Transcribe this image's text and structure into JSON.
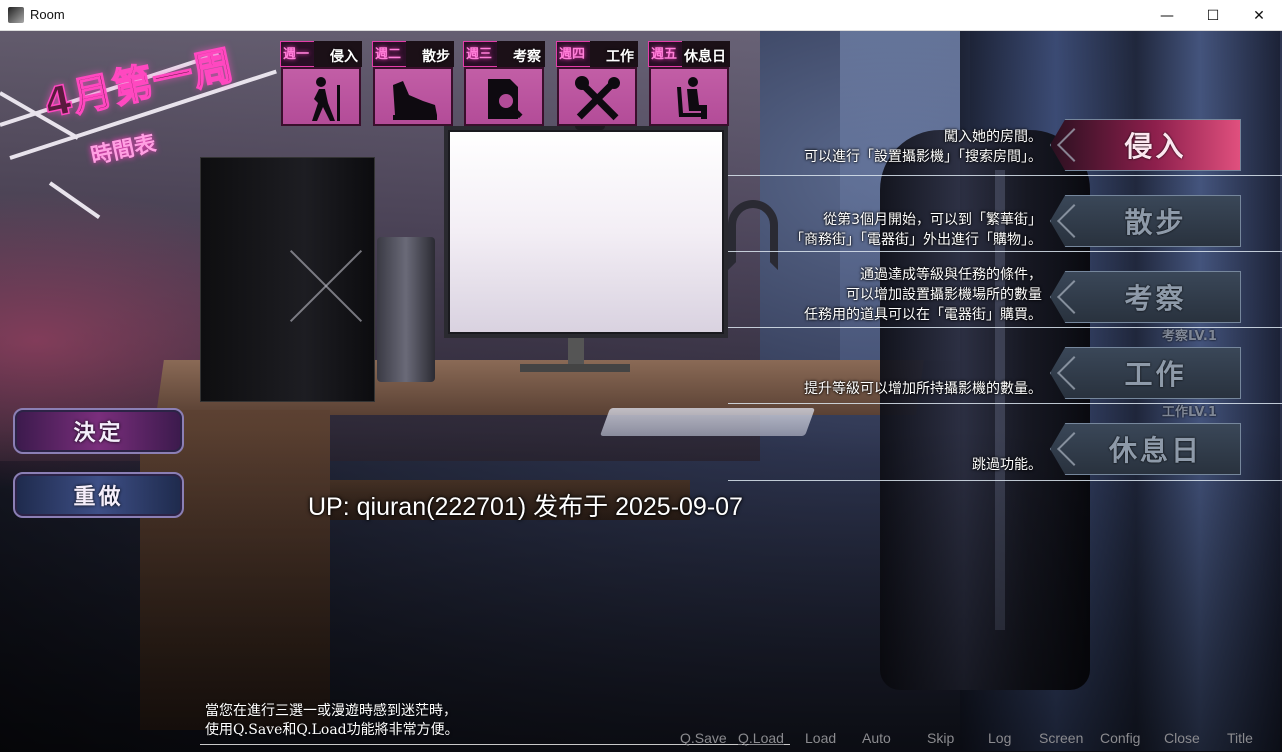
{
  "window": {
    "title": "Room",
    "min_symbol": "—",
    "max_symbol": "☐",
    "close_symbol": "✕"
  },
  "banner": {
    "date": "4月第一周",
    "schedule": "時間表"
  },
  "week_slots": [
    {
      "week": "週一",
      "action": "侵入",
      "icon": "walking-person-icon"
    },
    {
      "week": "週二",
      "action": "散步",
      "icon": "shoe-icon"
    },
    {
      "week": "週三",
      "action": "考察",
      "icon": "search-document-icon"
    },
    {
      "week": "週四",
      "action": "工作",
      "icon": "tools-icon"
    },
    {
      "week": "週五",
      "action": "休息日",
      "icon": "resting-person-icon"
    }
  ],
  "menu": [
    {
      "label": "侵入",
      "active": true,
      "desc": [
        "闖入她的房間。",
        "可以進行「設置攝影機」「搜索房間」。"
      ]
    },
    {
      "label": "散步",
      "active": false,
      "desc": [
        "從第3個月開始，可以到「繁華街」",
        "「商務街」「電器街」外出進行「購物」。"
      ]
    },
    {
      "label": "考察",
      "active": false,
      "level": "考察LV.1",
      "desc": [
        "通過達成等級與任務的條件，",
        "可以增加設置攝影機場所的數量",
        "任務用的道具可以在「電器街」購買。"
      ]
    },
    {
      "label": "工作",
      "active": false,
      "level": "工作LV.1",
      "desc": [
        "提升等級可以增加所持攝影機的數量。"
      ]
    },
    {
      "label": "休息日",
      "active": false,
      "desc": [
        "跳過功能。"
      ]
    }
  ],
  "buttons": {
    "decide": "決定",
    "redo": "重做"
  },
  "watermark": "UP: qiuran(222701) 发布于 2025-09-07",
  "hint": [
    "當您在進行三選一或漫遊時感到迷茫時，",
    "使用Q.Save和Q.Load功能將非常方便。"
  ],
  "quick_menu": [
    "Q.Save",
    "Q.Load",
    "Load",
    "Auto",
    "Skip",
    "Log",
    "Screen",
    "Config",
    "Close",
    "Title"
  ],
  "colors": {
    "accent_pink": "#ff48c0",
    "active_button": "#e0507e",
    "inactive_button": "#3a4758"
  }
}
